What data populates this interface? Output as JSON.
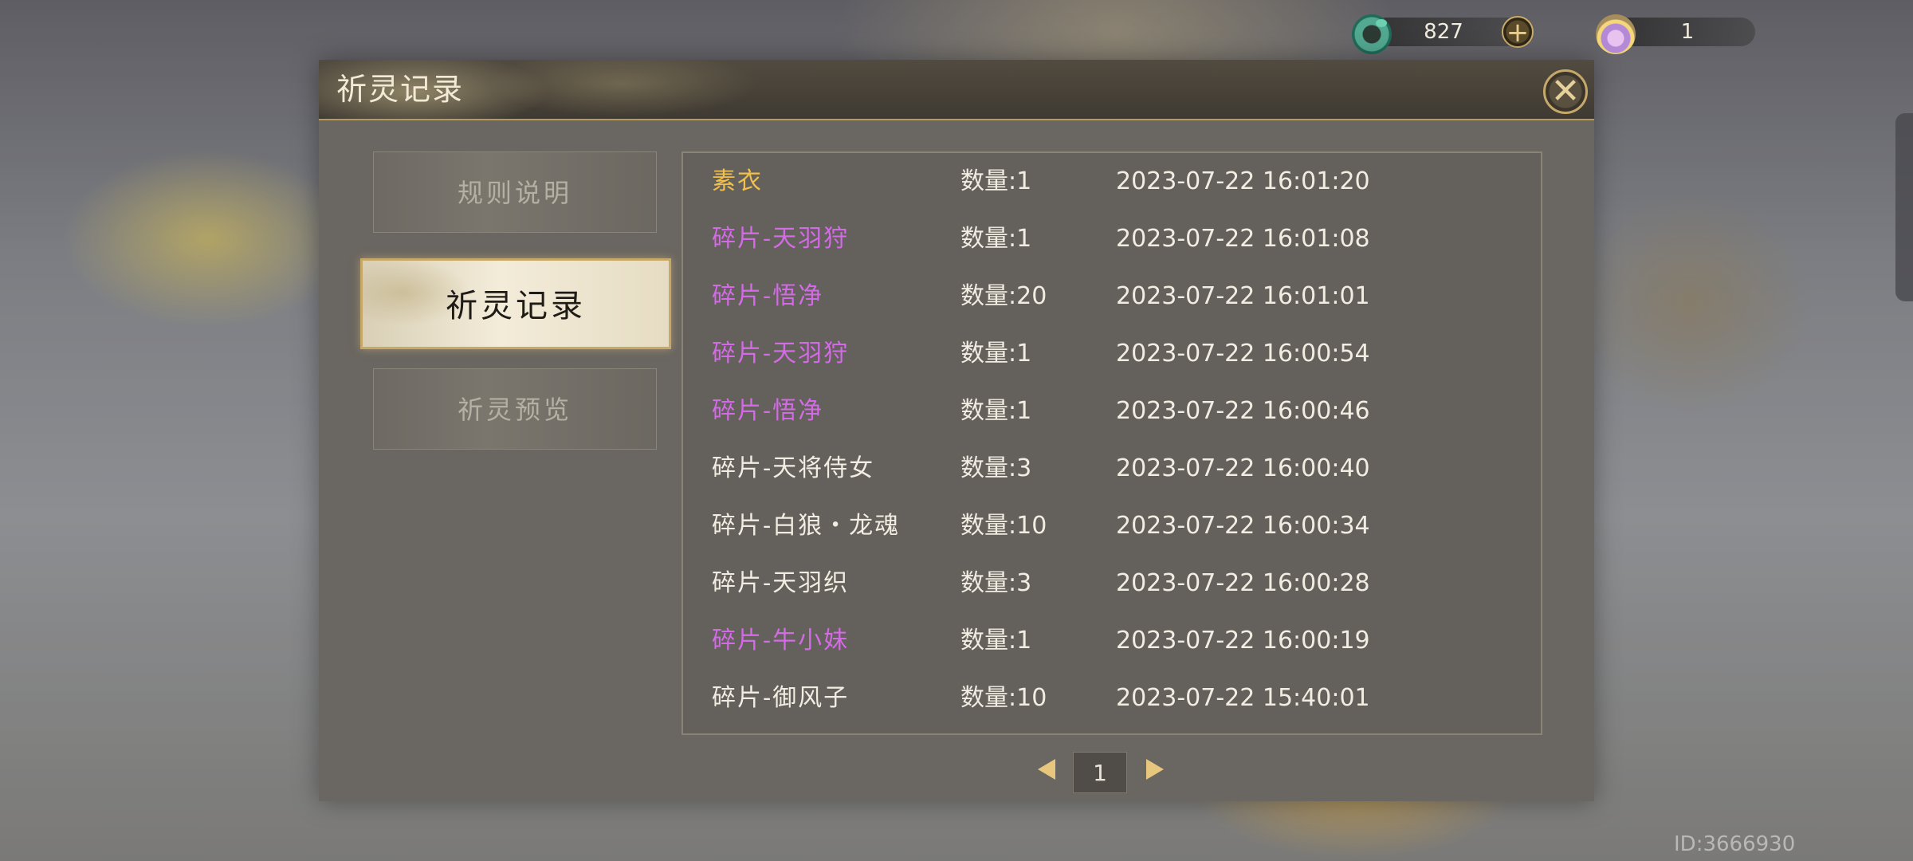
{
  "top_bar": {
    "jade": {
      "icon": "jade-coin-icon",
      "value": "827",
      "add_label": "+"
    },
    "lotus": {
      "icon": "lotus-orb-icon",
      "value": "1"
    }
  },
  "dialog": {
    "title": "祈灵记录",
    "close_label": "✕",
    "tabs": [
      {
        "label": "规则说明",
        "active": false
      },
      {
        "label": "祈灵记录",
        "active": true
      },
      {
        "label": "祈灵预览",
        "active": false
      }
    ],
    "records": [
      {
        "name": "素衣",
        "qty": "数量:1",
        "time": "2023-07-22 16:01:20",
        "rarity_color": "#efc04f"
      },
      {
        "name": "碎片-天羽狩",
        "qty": "数量:1",
        "time": "2023-07-22 16:01:08",
        "rarity_color": "#d36ae6"
      },
      {
        "name": "碎片-悟净",
        "qty": "数量:20",
        "time": "2023-07-22 16:01:01",
        "rarity_color": "#d36ae6"
      },
      {
        "name": "碎片-天羽狩",
        "qty": "数量:1",
        "time": "2023-07-22 16:00:54",
        "rarity_color": "#d36ae6"
      },
      {
        "name": "碎片-悟净",
        "qty": "数量:1",
        "time": "2023-07-22 16:00:46",
        "rarity_color": "#d36ae6"
      },
      {
        "name": "碎片-天将侍女",
        "qty": "数量:3",
        "time": "2023-07-22 16:00:40",
        "rarity_color": "#f2ede2"
      },
      {
        "name": "碎片-白狼・龙魂",
        "qty": "数量:10",
        "time": "2023-07-22 16:00:34",
        "rarity_color": "#f2ede2"
      },
      {
        "name": "碎片-天羽织",
        "qty": "数量:3",
        "time": "2023-07-22 16:00:28",
        "rarity_color": "#f2ede2"
      },
      {
        "name": "碎片-牛小妹",
        "qty": "数量:1",
        "time": "2023-07-22 16:00:19",
        "rarity_color": "#d36ae6"
      },
      {
        "name": "碎片-御风子",
        "qty": "数量:10",
        "time": "2023-07-22 15:40:01",
        "rarity_color": "#f2ede2"
      }
    ],
    "pager": {
      "current_page": "1"
    }
  },
  "footer": {
    "user_id": "ID:3666930"
  }
}
